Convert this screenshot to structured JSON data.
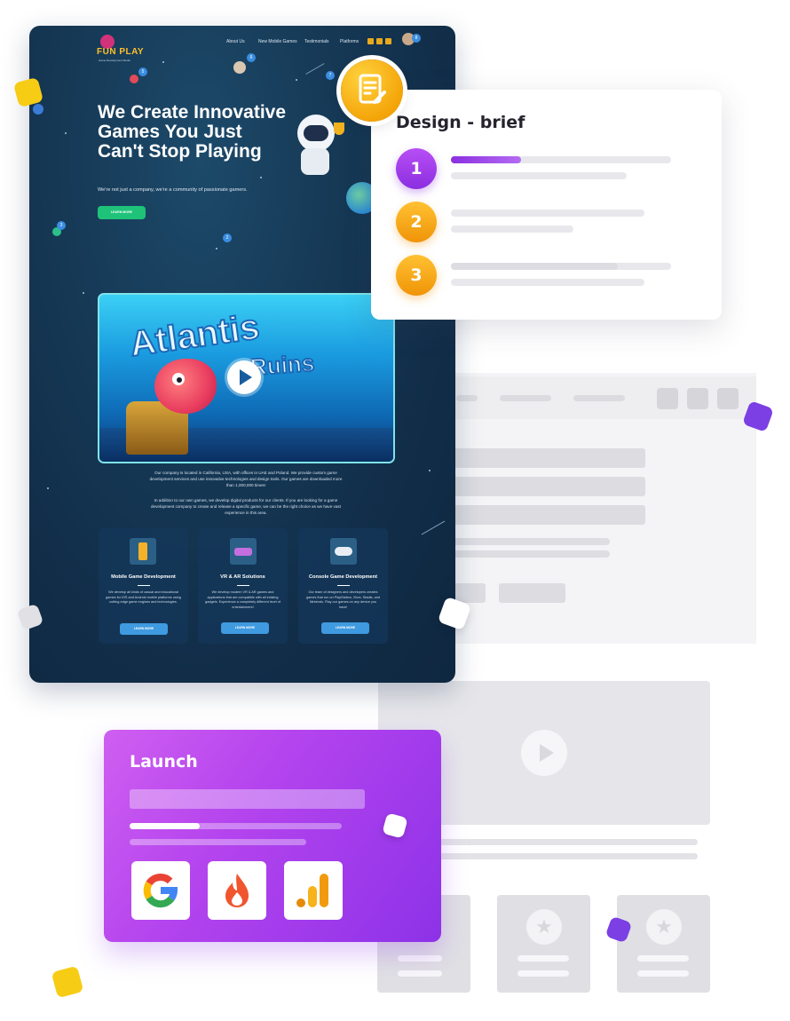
{
  "website": {
    "logo_text": "FUN PLAY",
    "logo_sub": "Game Development Studio",
    "nav": [
      "About Us",
      "New Mobile Games",
      "Testimonials",
      "Platforms"
    ],
    "hero_title": "We Create Innovative Games You Just Can't Stop Playing",
    "hero_subtitle": "We're not just a company, we're a community of passionate gamers.",
    "hero_button": "LEARN MORE",
    "map_numbers": [
      "1",
      "2",
      "3",
      "5",
      "6",
      "7",
      "8"
    ],
    "game_title": "Atlantis",
    "game_subtitle": "Ruins",
    "about_p1": "Our company is located in California, USA, with offices in UAE and Poland. We provide custom game development services and use innovative technologies and design tools. Our games are downloaded more than 1,000,000 times!",
    "about_p2": "In addition to our own games, we develop digital products for our clients. If you are looking for a game development company to create and release a specific game, we can be the right choice as we have vast experience in this area.",
    "services": [
      {
        "title": "Mobile Game Development",
        "text": "We develop all kinds of casual and educational games for iOS and Android mobile platforms using cutting-edge game engines and technologies.",
        "button": "LEARN MORE",
        "icon": "phone-icon"
      },
      {
        "title": "VR & AR Solutions",
        "text": "We develop modern VR & AR games and applications that are compatible with all existing gadgets. Experience a completely different level of entertainment!",
        "button": "LEARN MORE",
        "icon": "vr-headset-icon"
      },
      {
        "title": "Console Game Development",
        "text": "Our team of designers and developers creates games that run on PlayStation, Xbox, Stadia, and Nintendo. Play our games on any device you have!",
        "button": "LEARN MORE",
        "icon": "gamepad-icon"
      }
    ]
  },
  "brief": {
    "title": "Design - brief",
    "steps": [
      "1",
      "2",
      "3"
    ],
    "badge_icon": "document-edit-icon",
    "step1_progress": 0.32
  },
  "launch": {
    "title": "Launch",
    "progress": 0.33,
    "tiles": [
      "google-icon",
      "firebase-icon",
      "analytics-icon"
    ]
  },
  "colors": {
    "purple": "#8b2fe0",
    "orange": "#f4a509",
    "green": "#1fc279",
    "yellow_square": "#f7cc15",
    "navy": "#112d48"
  }
}
